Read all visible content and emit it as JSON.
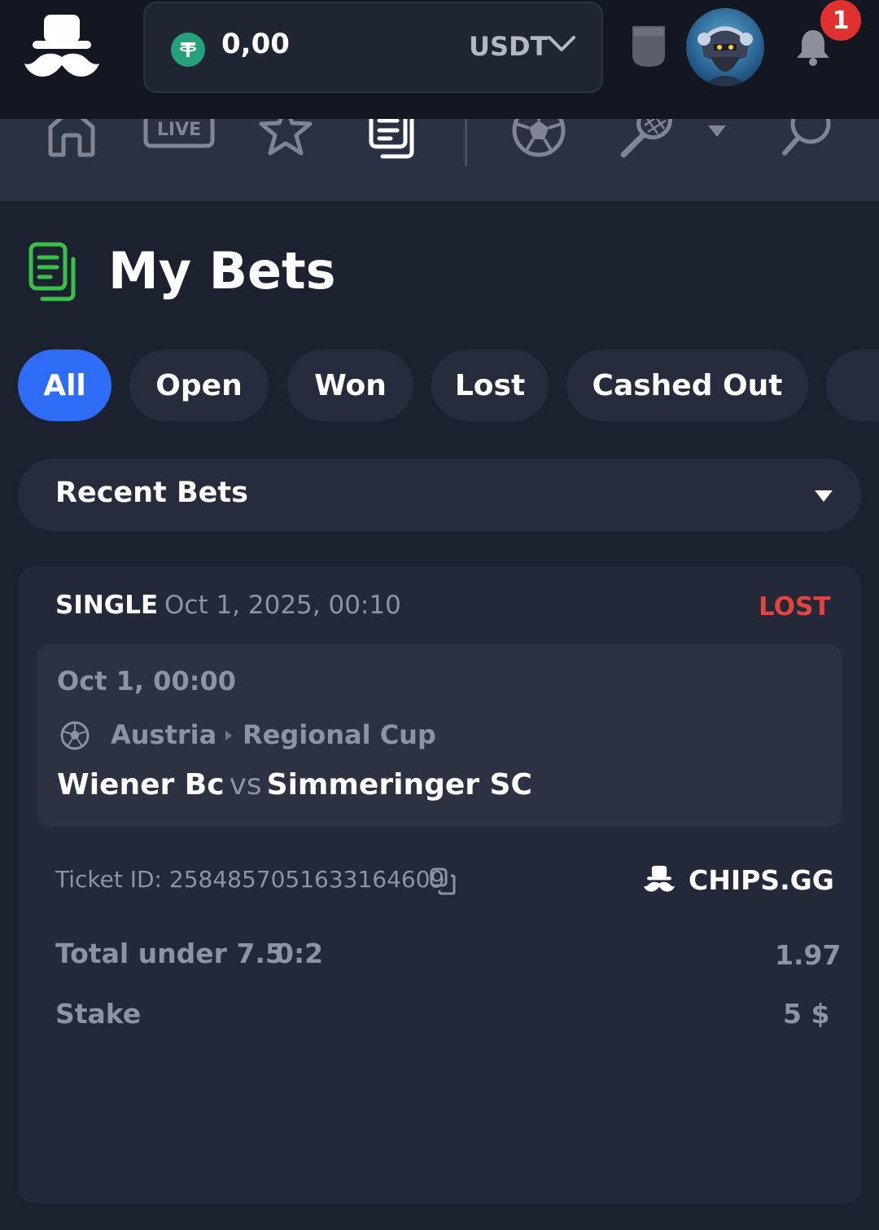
{
  "header": {
    "balance": "0,00",
    "currency": "USDT",
    "notification_count": "1",
    "icons": [
      "mustache-logo-icon",
      "tether-icon",
      "chevron-down-icon",
      "shield-icon",
      "avatar",
      "bell-icon"
    ]
  },
  "nav": {
    "icons": [
      "home-icon",
      "live-icon",
      "star-icon",
      "my-bets-icon",
      "soccer-ball-icon",
      "tennis-racket-icon",
      "caret-down-icon",
      "search-icon"
    ],
    "live_label": "LIVE"
  },
  "page": {
    "title": "My Bets"
  },
  "filters": {
    "tabs": [
      {
        "label": "All",
        "active": true
      },
      {
        "label": "Open",
        "active": false
      },
      {
        "label": "Won",
        "active": false
      },
      {
        "label": "Lost",
        "active": false
      },
      {
        "label": "Cashed Out",
        "active": false
      }
    ]
  },
  "dropdown": {
    "label": "Recent Bets"
  },
  "bet": {
    "type": "SINGLE",
    "placed_at": "Oct 1, 2025, 00:10",
    "status": "LOST",
    "event": {
      "time": "Oct 1, 00:00",
      "country": "Austria",
      "league": "Regional Cup",
      "home": "Wiener Bc",
      "vs": "vs",
      "away": "Simmeringer SC"
    },
    "ticket_id": "Ticket ID: 2584857051633164609",
    "brand": "CHIPS.GG",
    "selection": "Total under 7.5",
    "score": "0:2",
    "odds": "1.97",
    "stake_label": "Stake",
    "stake_value": "5 $"
  },
  "colors": {
    "accent_blue": "#2f6cf6",
    "lost_red": "#e5433f",
    "brand_green": "#3bbf4a",
    "tether_green": "#26a17b",
    "badge_red": "#e03131"
  }
}
